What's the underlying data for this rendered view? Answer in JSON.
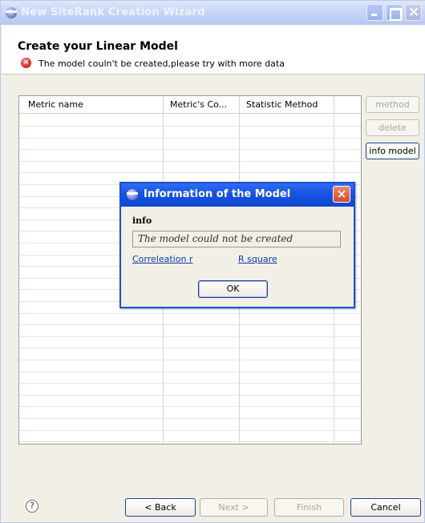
{
  "window": {
    "title": "New SiteRank Creation Wizard"
  },
  "header": {
    "page_title": "Create your Linear Model",
    "error_message": "The model couln't be created,please try with more data"
  },
  "table": {
    "columns": [
      "Metric name",
      "Metric's Co...",
      "Statistic Method"
    ]
  },
  "side_buttons": {
    "method": "method",
    "delete": "delete",
    "info_model": "info model"
  },
  "footer": {
    "help": "?",
    "back": "< Back",
    "next": "Next >",
    "finish": "Finish",
    "cancel": "Cancel"
  },
  "dialog": {
    "title": "Information of the Model",
    "info_label": "info",
    "info_value": "The model could not be created",
    "correlation_link": "Correleation r",
    "rsquare_link": "R square",
    "ok": "OK"
  },
  "colors": {
    "dialog_title_blue": "#1553df",
    "error_red": "#d3231f",
    "link_blue": "#0b3ea8"
  }
}
